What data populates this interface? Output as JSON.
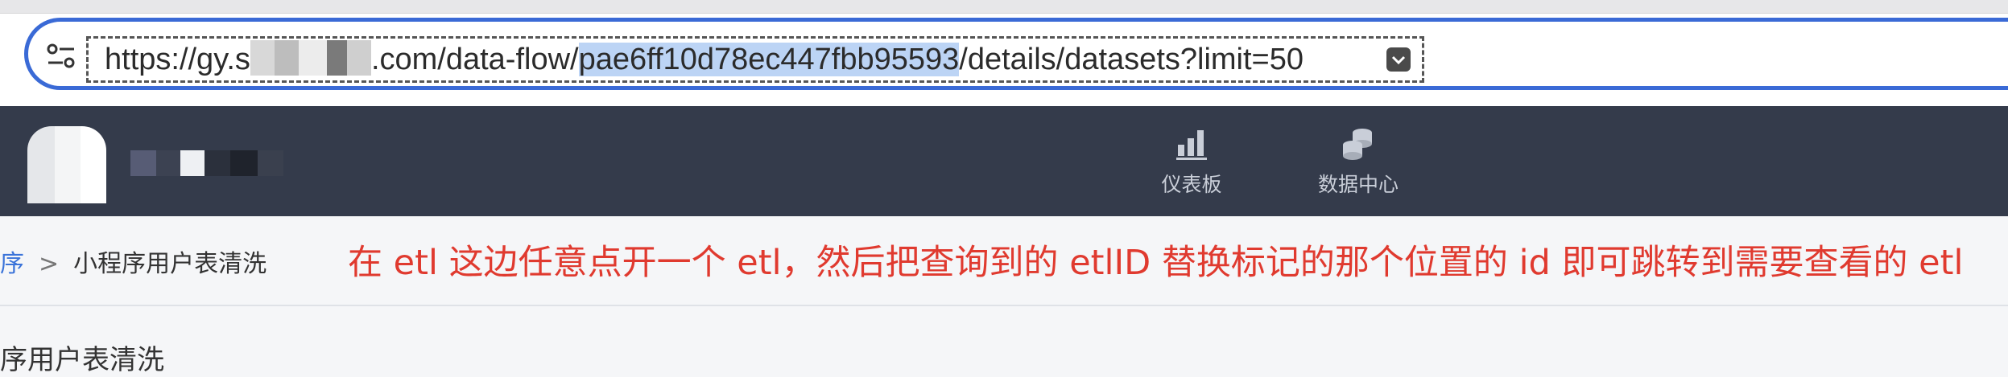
{
  "browser": {
    "url_prefix": "https://gy.s",
    "url_domain_suffix": ".com/data-flow/",
    "url_highlighted_id": "pae6ff10d78ec447fbb95593",
    "url_suffix": "/details/datasets?limit=50",
    "highlight_color": "#bcd4f5",
    "accent_color": "#3a6ad6"
  },
  "navbar": {
    "background": "#343b4b",
    "items": [
      {
        "label": "仪表板",
        "icon": "bar-chart-icon"
      },
      {
        "label": "数据中心",
        "icon": "database-icon"
      }
    ]
  },
  "breadcrumb": {
    "parent": "序",
    "separator": ">",
    "current": "小程序用户表清洗"
  },
  "page": {
    "title": "序用户表清洗"
  },
  "annotation": {
    "text": "在 etl 这边任意点开一个 etl，然后把查询到的 etlID 替换标记的那个位置的 id 即可跳转到需要查看的 etl",
    "color": "#e03a2f"
  }
}
